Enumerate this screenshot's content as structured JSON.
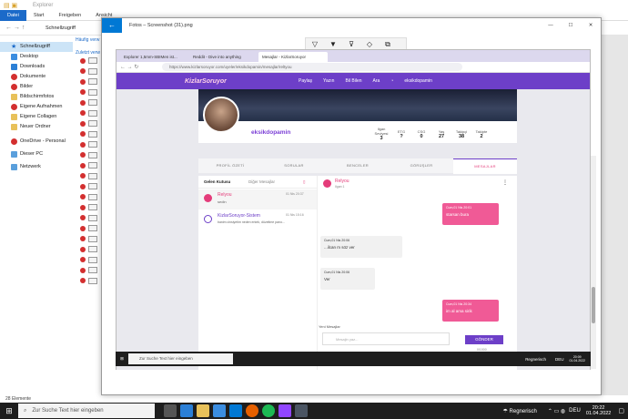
{
  "explorer": {
    "title": "Explorer",
    "tabs": [
      "Datei",
      "Start",
      "Freigeben",
      "Ansicht"
    ],
    "address": "Schnellzugriff",
    "nav": [
      {
        "label": "Schnellzugriff"
      },
      {
        "label": "Desktop"
      },
      {
        "label": "Downloads"
      },
      {
        "label": "Dokumente"
      },
      {
        "label": "Bilder"
      },
      {
        "label": "Bildschirmfotos"
      },
      {
        "label": "Eigene Aufnahmen"
      },
      {
        "label": "Eigene Collagen"
      },
      {
        "label": "Neuer Ordner"
      },
      {
        "label": "OneDrive - Personal"
      },
      {
        "label": "Dieser PC"
      },
      {
        "label": "Netzwerk"
      }
    ],
    "group1": "Häufig verw",
    "group2": "Zuletzt verw",
    "status": "28 Elemente"
  },
  "photos": {
    "title": "Fotos – Screenshot (31).png",
    "controls": [
      "—",
      "☐",
      "✕"
    ]
  },
  "browser": {
    "tabs": [
      "Explorer 1,5mm-SBIMen ist...",
      "Reddit - Dive into anything",
      "Mesajlar - KizlarSoruyor"
    ],
    "url": "https://www.kizlarsoruyor.com/uyeler/eksikdopamin/mesajlar/reltyou"
  },
  "site": {
    "logo": "KizlarSoruyor",
    "nav": [
      "Paylaş",
      "Yazın",
      "Bil Bilen",
      "Ara"
    ],
    "user": "eksikdopamin"
  },
  "profile": {
    "username": "eksikdopamin",
    "stats": [
      {
        "label": "Ilgan Seviyesi",
        "value": "3"
      },
      {
        "label": "ETG",
        "value": "?"
      },
      {
        "label": "CSG",
        "value": "0"
      },
      {
        "label": "Yaş",
        "value": "27"
      },
      {
        "label": "Takipçi",
        "value": "38"
      },
      {
        "label": "Takipte",
        "value": "2"
      }
    ]
  },
  "ptabs": [
    "PROFİL ÖZETİ",
    "SORULAR",
    "BENCELER",
    "GÖRÜŞLER",
    "MESAJLAR"
  ],
  "inbox": {
    "tab1": "Gelen Kutusu",
    "tab2": "Diğer Mesajlar",
    "items": [
      {
        "name": "Relyou",
        "time": "01 Nis 20:37",
        "preview": "sedin"
      },
      {
        "name": "KizlarSoruyor-Sistem",
        "time": "01 Nis 15:16",
        "preview": "banim cinsiyetim neden erkek, düzeltme pano..."
      }
    ]
  },
  "chat": {
    "name": "Relyou",
    "sub": "Ilgan 1",
    "messages": [
      {
        "time": "Cum,01 Nis 20:01",
        "text": "starsan bura"
      },
      {
        "time": "Cum,01 Nis 20:06",
        "text": "...ilcan m söz ver"
      },
      {
        "time": "Cum,01 Nis 20:06",
        "text": "Ver"
      },
      {
        "time": "Cum,01 Nis 20:34",
        "text": "im al ama sirik"
      }
    ],
    "newmsg": "Yeni Mesajlar",
    "placeholder": "Mesajin yaz...",
    "send": "GÖNDER",
    "count": "0/1000"
  },
  "inner_taskbar": {
    "search": "Zur Suche Text hier eingeben",
    "weather": "Regnerisch",
    "lang": "DEU",
    "time": "20:09",
    "date": "01.04.2022"
  },
  "taskbar": {
    "search": "Zur Suche Text hier eingeben",
    "weather": "Regnerisch",
    "lang": "DEU",
    "time": "20:22",
    "date": "01.04.2022"
  }
}
